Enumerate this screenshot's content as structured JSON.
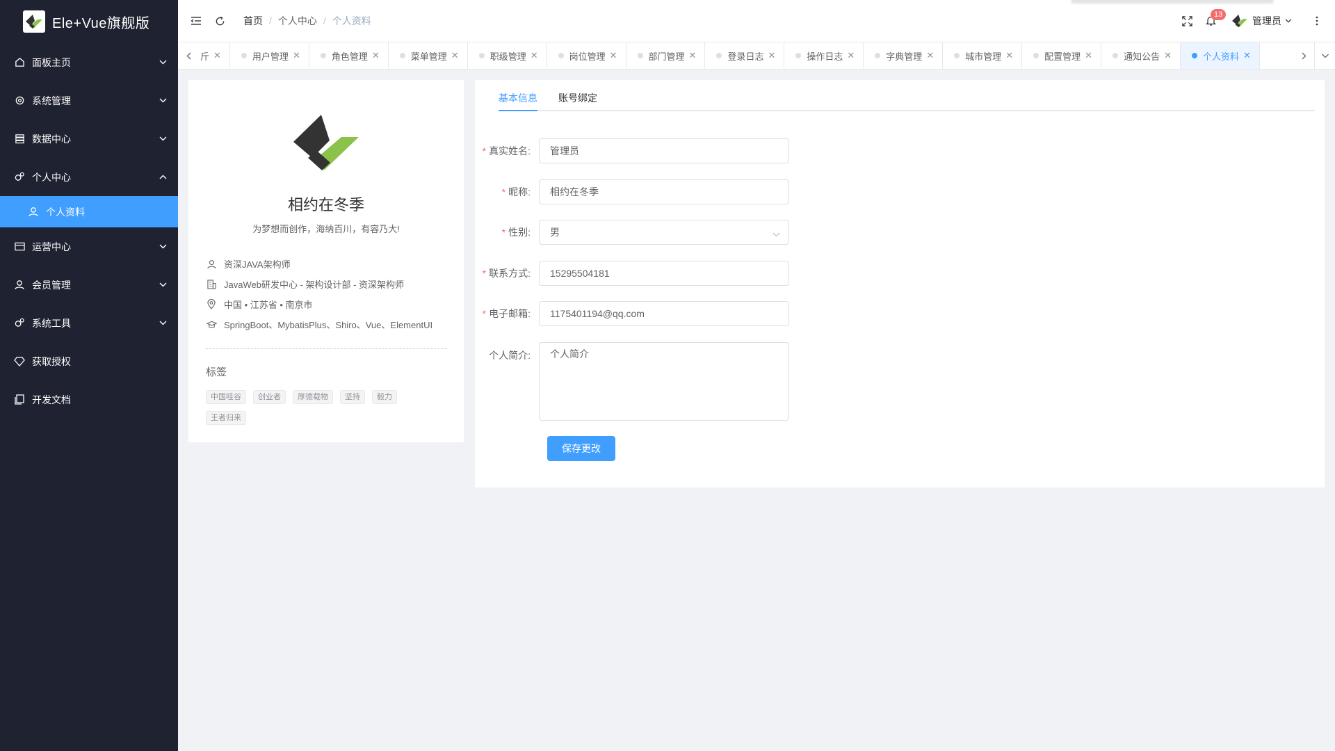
{
  "app": {
    "title": "Ele+Vue旗舰版"
  },
  "sidebar": {
    "items": [
      {
        "label": "面板主页",
        "icon": "home-icon"
      },
      {
        "label": "系统管理",
        "icon": "gear-icon"
      },
      {
        "label": "数据中心",
        "icon": "database-icon"
      },
      {
        "label": "个人中心",
        "icon": "gears-icon",
        "expanded": true
      },
      {
        "label": "运营中心",
        "icon": "card-icon"
      },
      {
        "label": "会员管理",
        "icon": "user-icon"
      },
      {
        "label": "系统工具",
        "icon": "gears-icon"
      },
      {
        "label": "获取授权",
        "icon": "diamond-icon"
      },
      {
        "label": "开发文档",
        "icon": "document-icon"
      }
    ],
    "sub_item": {
      "label": "个人资料",
      "icon": "user-icon",
      "active": true
    }
  },
  "header": {
    "breadcrumb": [
      "首页",
      "个人中心",
      "个人资料"
    ],
    "notification_count": "13",
    "username": "管理员"
  },
  "tabs": [
    {
      "label": "斤",
      "partial": true
    },
    {
      "label": "用户管理"
    },
    {
      "label": "角色管理"
    },
    {
      "label": "菜单管理"
    },
    {
      "label": "职级管理"
    },
    {
      "label": "岗位管理"
    },
    {
      "label": "部门管理"
    },
    {
      "label": "登录日志"
    },
    {
      "label": "操作日志"
    },
    {
      "label": "字典管理"
    },
    {
      "label": "城市管理"
    },
    {
      "label": "配置管理"
    },
    {
      "label": "通知公告"
    },
    {
      "label": "个人资料",
      "active": true
    }
  ],
  "profile": {
    "name": "相约在冬季",
    "motto": "为梦想而创作，海纳百川，有容乃大!",
    "info": [
      {
        "icon": "user-icon",
        "text": "资深JAVA架构师"
      },
      {
        "icon": "building-icon",
        "text": "JavaWeb研发中心 - 架构设计部 - 资深架构师"
      },
      {
        "icon": "location-icon",
        "text": "中国 • 江苏省 • 南京市"
      },
      {
        "icon": "graduation-cap-icon",
        "text": "SpringBoot、MybatisPlus、Shiro、Vue、ElementUI"
      }
    ],
    "tags_title": "标签",
    "tags": [
      "中国哇谷",
      "创业者",
      "厚德载物",
      "坚持",
      "毅力",
      "王者归来"
    ]
  },
  "form": {
    "tabs": [
      "基本信息",
      "账号绑定"
    ],
    "active_tab": "基本信息",
    "fields": {
      "realname": {
        "label": "真实姓名:",
        "value": "管理员",
        "required": true
      },
      "nickname": {
        "label": "昵称:",
        "value": "相约在冬季",
        "required": true
      },
      "gender": {
        "label": "性别:",
        "value": "男",
        "required": true
      },
      "mobile": {
        "label": "联系方式:",
        "value": "15295504181",
        "required": true
      },
      "email": {
        "label": "电子邮箱:",
        "value": "1175401194@qq.com",
        "required": true
      },
      "intro": {
        "label": "个人简介:",
        "value": "个人简介",
        "required": false
      }
    },
    "save_label": "保存更改"
  },
  "colors": {
    "sidebar_bg": "#1f2230",
    "primary": "#409eff",
    "accent_green": "#8bc34a",
    "danger": "#f56c6c"
  }
}
